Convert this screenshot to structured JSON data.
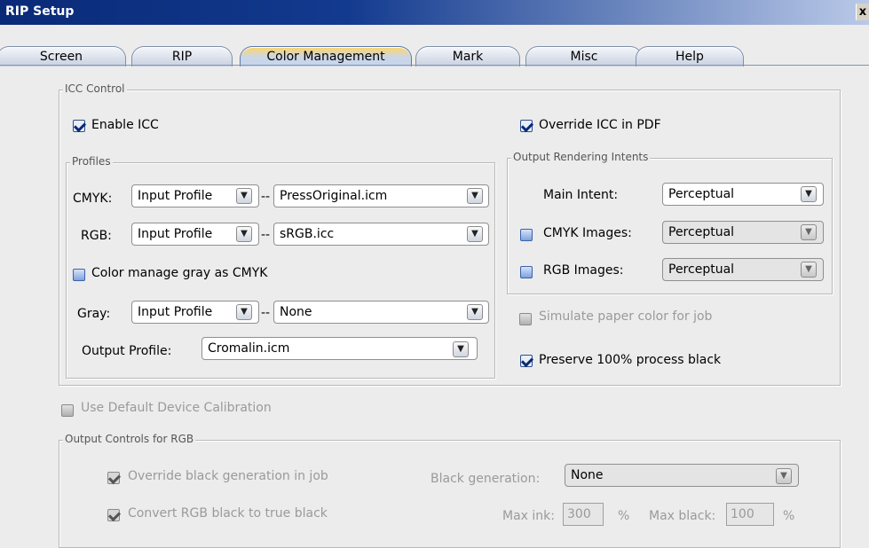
{
  "window": {
    "title": "RIP Setup",
    "close_glyph": "x"
  },
  "tabs": [
    {
      "label": "Screen"
    },
    {
      "label": "RIP"
    },
    {
      "label": "Color Management"
    },
    {
      "label": "Mark"
    },
    {
      "label": "Misc"
    },
    {
      "label": "Help"
    }
  ],
  "active_tab": "Color Management",
  "icc_control": {
    "legend": "ICC Control",
    "enable_icc": {
      "label": "Enable ICC",
      "checked": true
    },
    "override_icc_pdf": {
      "label": "Override ICC in PDF",
      "checked": true
    },
    "profiles": {
      "legend": "Profiles",
      "cmyk": {
        "label": "CMYK:",
        "source": "Input Profile",
        "profile": "PressOriginal.icm"
      },
      "rgb": {
        "label": "RGB:",
        "source": "Input Profile",
        "profile": "sRGB.icc"
      },
      "manage_gray": {
        "label": "Color manage gray as CMYK",
        "checked": false
      },
      "gray": {
        "label": "Gray:",
        "source": "Input Profile",
        "profile": "None"
      },
      "output": {
        "label": "Output Profile:",
        "profile": "Cromalin.icm"
      },
      "separator": "--"
    },
    "intents": {
      "legend": "Output Rendering Intents",
      "main": {
        "label": "Main Intent:",
        "value": "Perceptual"
      },
      "cmyk_images": {
        "label": "CMYK Images:",
        "value": "Perceptual",
        "checked": false
      },
      "rgb_images": {
        "label": "RGB Images:",
        "value": "Perceptual",
        "checked": false
      }
    },
    "simulate_paper": {
      "label": "Simulate paper color for job",
      "checked": false,
      "enabled": false
    },
    "preserve_black": {
      "label": "Preserve 100% process black",
      "checked": true
    }
  },
  "use_default_calibration": {
    "label": "Use Default Device Calibration",
    "checked": false,
    "enabled": false
  },
  "rgb_controls": {
    "legend": "Output Controls for RGB",
    "override_black": {
      "label": "Override black generation in job",
      "checked": true
    },
    "convert_black": {
      "label": "Convert RGB black to true black",
      "checked": true
    },
    "black_generation": {
      "label": "Black generation:",
      "value": "None"
    },
    "max_ink": {
      "label": "Max ink:",
      "value": "300",
      "unit": "%"
    },
    "max_black": {
      "label": "Max black:",
      "value": "100",
      "unit": "%"
    }
  },
  "colors": {
    "title_bar": "#0a2a78",
    "accent": "#ffd56a",
    "background": "#ececec"
  }
}
